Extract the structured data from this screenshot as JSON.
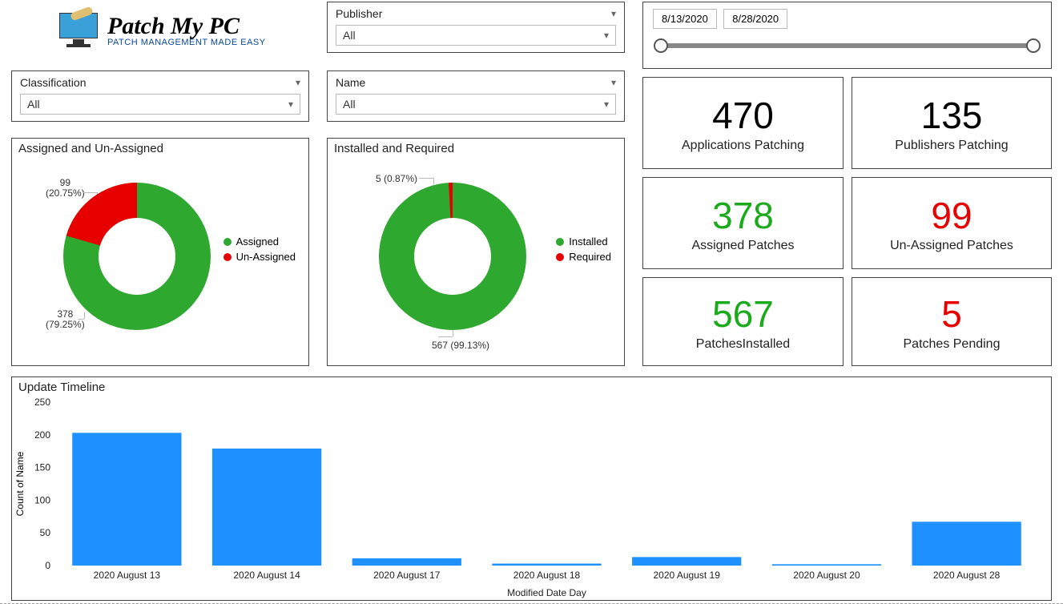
{
  "logo": {
    "main": "Patch My PC",
    "sub": "PATCH MANAGEMENT MADE EASY"
  },
  "filters": {
    "classification": {
      "label": "Classification",
      "value": "All"
    },
    "publisher": {
      "label": "Publisher",
      "value": "All"
    },
    "name": {
      "label": "Name",
      "value": "All"
    }
  },
  "date_range": {
    "start": "8/13/2020",
    "end": "8/28/2020"
  },
  "donut_assigned": {
    "title": "Assigned and Un-Assigned",
    "legend": {
      "a": "Assigned",
      "b": "Un-Assigned"
    },
    "label_assigned_n": "378",
    "label_assigned_p": "(79.25%)",
    "label_un_n": "99",
    "label_un_p": "(20.75%)"
  },
  "donut_installed": {
    "title": "Installed and Required",
    "legend": {
      "a": "Installed",
      "b": "Required"
    },
    "label_installed": "567 (99.13%)",
    "label_required": "5 (0.87%)"
  },
  "kpis": {
    "apps_patching": {
      "val": "470",
      "lbl": "Applications Patching"
    },
    "pub_patching": {
      "val": "135",
      "lbl": "Publishers Patching"
    },
    "assigned": {
      "val": "378",
      "lbl": "Assigned Patches"
    },
    "unassigned": {
      "val": "99",
      "lbl": "Un-Assigned Patches"
    },
    "installed": {
      "val": "567",
      "lbl": "PatchesInstalled"
    },
    "pending": {
      "val": "5",
      "lbl": "Patches Pending"
    }
  },
  "timeline": {
    "title": "Update Timeline",
    "xlabel": "Modified Date Day",
    "ylabel": "Count of Name"
  },
  "chart_data": [
    {
      "type": "pie",
      "title": "Assigned and Un-Assigned",
      "series": [
        {
          "name": "Assigned",
          "value": 378,
          "pct": 79.25,
          "color": "#2fa82f"
        },
        {
          "name": "Un-Assigned",
          "value": 99,
          "pct": 20.75,
          "color": "#e60000"
        }
      ]
    },
    {
      "type": "pie",
      "title": "Installed and Required",
      "series": [
        {
          "name": "Installed",
          "value": 567,
          "pct": 99.13,
          "color": "#2fa82f"
        },
        {
          "name": "Required",
          "value": 5,
          "pct": 0.87,
          "color": "#e60000"
        }
      ]
    },
    {
      "type": "bar",
      "title": "Update Timeline",
      "xlabel": "Modified Date Day",
      "ylabel": "Count of Name",
      "ylim": [
        0,
        250
      ],
      "yticks": [
        0,
        50,
        100,
        150,
        200,
        250
      ],
      "categories": [
        "2020 August 13",
        "2020 August 14",
        "2020 August 17",
        "2020 August 18",
        "2020 August 19",
        "2020 August 20",
        "2020 August 28"
      ],
      "values": [
        203,
        179,
        11,
        3,
        13,
        2,
        67
      ],
      "color": "#1e90ff"
    }
  ]
}
